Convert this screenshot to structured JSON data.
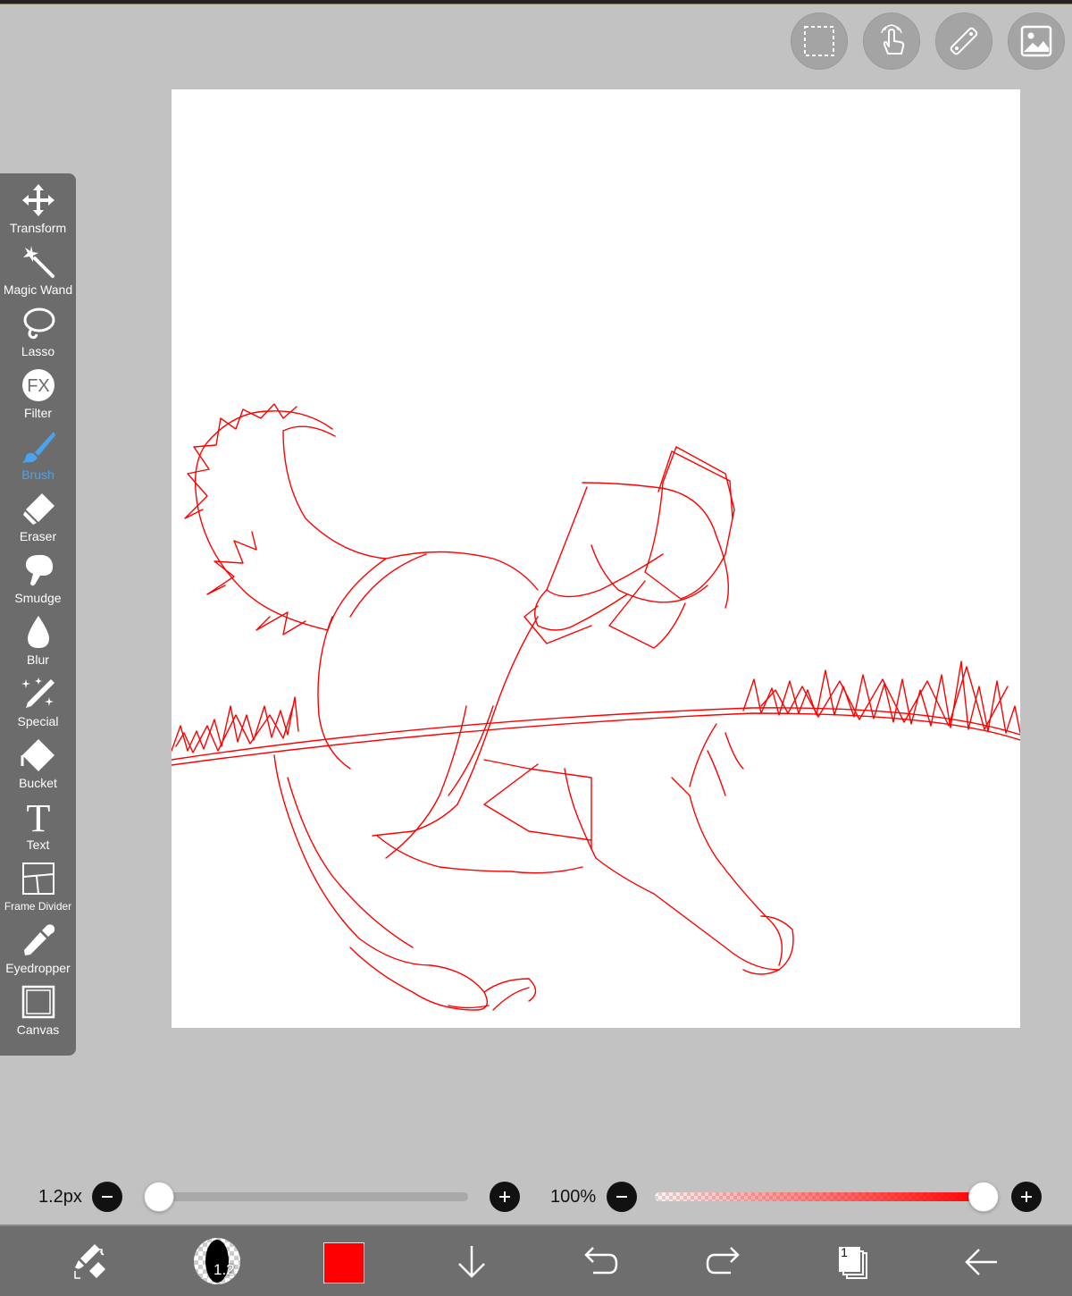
{
  "colors": {
    "background": "#c2c2c2",
    "toolbar": "#6c6c6c",
    "active_tool": "#4aa3f0",
    "stroke": "#ff0000",
    "bottom_bar": "#6e6e6e"
  },
  "top_buttons": [
    {
      "name": "selection-icon"
    },
    {
      "name": "touch-gesture-icon"
    },
    {
      "name": "ruler-icon"
    },
    {
      "name": "image-icon"
    }
  ],
  "tools": [
    {
      "id": "transform",
      "label": "Transform",
      "icon": "move-arrows-icon"
    },
    {
      "id": "magic-wand",
      "label": "Magic Wand",
      "icon": "magic-wand-icon"
    },
    {
      "id": "lasso",
      "label": "Lasso",
      "icon": "lasso-icon"
    },
    {
      "id": "filter",
      "label": "Filter",
      "icon": "fx-icon",
      "icon_text": "FX"
    },
    {
      "id": "brush",
      "label": "Brush",
      "icon": "brush-icon",
      "active": true
    },
    {
      "id": "eraser",
      "label": "Eraser",
      "icon": "eraser-icon"
    },
    {
      "id": "smudge",
      "label": "Smudge",
      "icon": "smudge-icon"
    },
    {
      "id": "blur",
      "label": "Blur",
      "icon": "droplet-icon"
    },
    {
      "id": "special",
      "label": "Special",
      "icon": "special-pen-icon"
    },
    {
      "id": "bucket",
      "label": "Bucket",
      "icon": "bucket-icon"
    },
    {
      "id": "text",
      "label": "Text",
      "icon": "text-icon",
      "icon_text": "T"
    },
    {
      "id": "frame-divider",
      "label": "Frame Divider",
      "icon": "frame-divider-icon"
    },
    {
      "id": "eyedropper",
      "label": "Eyedropper",
      "icon": "eyedropper-icon"
    },
    {
      "id": "canvas",
      "label": "Canvas",
      "icon": "canvas-icon"
    }
  ],
  "size_slider": {
    "label": "1.2px",
    "value_fraction": 0.0
  },
  "opacity_slider": {
    "label": "100%",
    "value_fraction": 1.0
  },
  "bottom_bar": {
    "brush_size_text": "1.2",
    "current_color": "#ff0000",
    "layer_count": "1"
  }
}
